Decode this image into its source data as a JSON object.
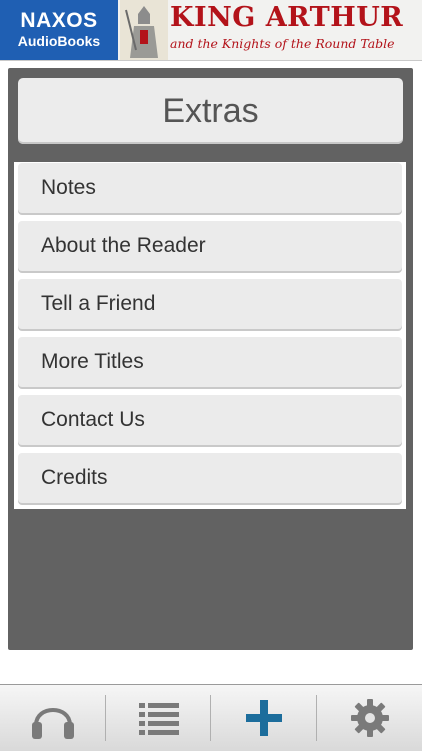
{
  "banner": {
    "logo_line1": "NAXOS",
    "logo_line2": "AudioBooks",
    "title": "KING ARTHUR",
    "subtitle": "and the Knights of the Round Table"
  },
  "page": {
    "heading": "Extras"
  },
  "menu": {
    "items": [
      {
        "label": "Notes"
      },
      {
        "label": "About the Reader"
      },
      {
        "label": "Tell a Friend"
      },
      {
        "label": "More Titles"
      },
      {
        "label": "Contact Us"
      },
      {
        "label": "Credits"
      }
    ]
  },
  "toolbar": {
    "items": [
      {
        "icon": "headphones-icon"
      },
      {
        "icon": "list-icon"
      },
      {
        "icon": "plus-icon",
        "active": true
      },
      {
        "icon": "gear-icon"
      }
    ]
  },
  "colors": {
    "brand_blue": "#1f5fb3",
    "title_red": "#b3131a",
    "panel_gray": "#626262",
    "active_icon": "#1c6d9c",
    "inactive_icon": "#7a7a7a"
  }
}
